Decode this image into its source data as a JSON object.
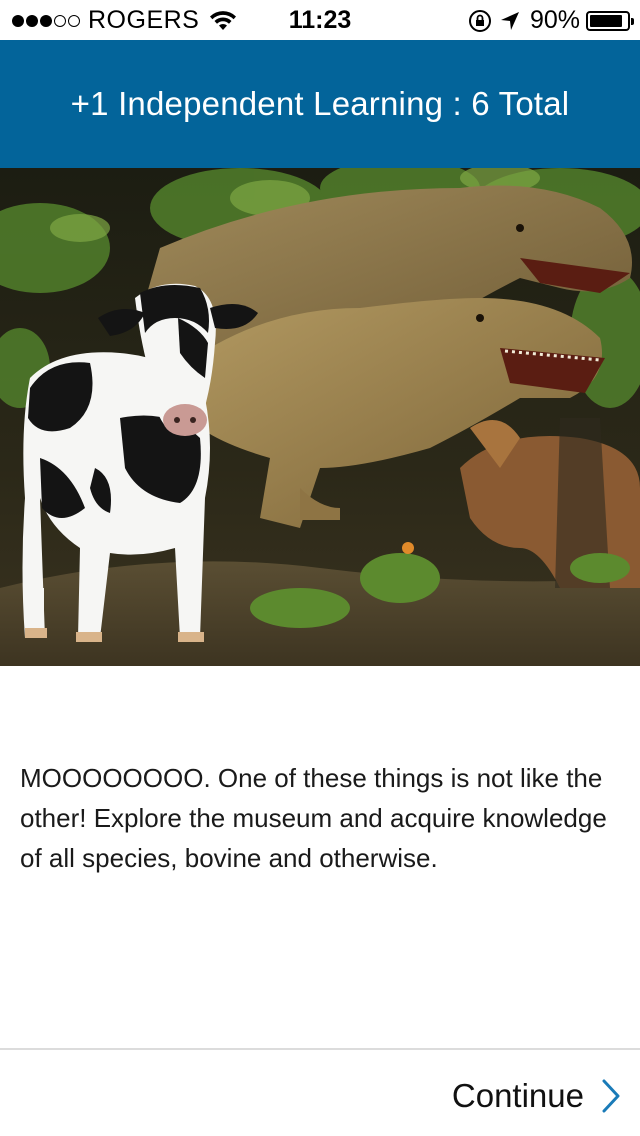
{
  "status_bar": {
    "carrier": "ROGERS",
    "time": "11:23",
    "battery_percent": "90%",
    "battery_level": 0.9,
    "signal_bars": 3,
    "signal_total": 5
  },
  "header": {
    "title": "+1 Independent Learning : 6 Total",
    "background_color": "#03649a"
  },
  "hero": {
    "description_icon": "museum-photo"
  },
  "message": {
    "text": "MOOOOOOOO. One of these things is not like the other! Explore the museum and acquire knowledge of all species, bovine and otherwise."
  },
  "footer": {
    "continue_label": "Continue",
    "chevron_color": "#1a7bb8"
  }
}
